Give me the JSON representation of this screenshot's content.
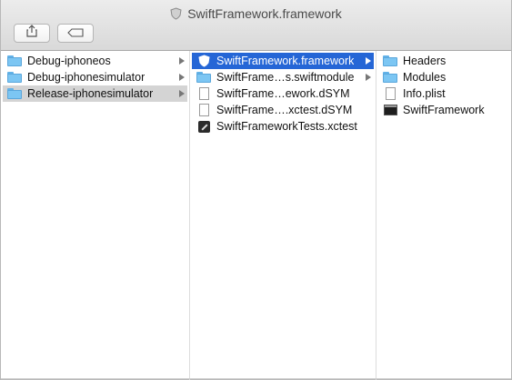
{
  "window": {
    "title": "SwiftFramework.framework"
  },
  "toolbar": {
    "share_icon": "share-icon",
    "tag_icon": "tag-icon"
  },
  "columns": {
    "col1": [
      {
        "label": "Debug-iphoneos",
        "icon": "folder-icon",
        "has_arrow": true,
        "state": "normal"
      },
      {
        "label": "Debug-iphonesimulator",
        "icon": "folder-icon",
        "has_arrow": true,
        "state": "normal"
      },
      {
        "label": "Release-iphonesimulator",
        "icon": "folder-icon",
        "has_arrow": true,
        "state": "selected-inactive"
      }
    ],
    "col2": [
      {
        "label": "SwiftFramework.framework",
        "icon": "framework-icon",
        "has_arrow": true,
        "state": "selected-active"
      },
      {
        "label": "SwiftFrame…s.swiftmodule",
        "icon": "folder-icon",
        "has_arrow": true,
        "state": "normal"
      },
      {
        "label": "SwiftFrame…ework.dSYM",
        "icon": "document-icon",
        "has_arrow": false,
        "state": "normal"
      },
      {
        "label": "SwiftFrame….xctest.dSYM",
        "icon": "document-icon",
        "has_arrow": false,
        "state": "normal"
      },
      {
        "label": "SwiftFrameworkTests.xctest",
        "icon": "xctest-icon",
        "has_arrow": false,
        "state": "normal"
      }
    ],
    "col3": [
      {
        "label": "Headers",
        "icon": "folder-icon",
        "has_arrow": false,
        "state": "normal"
      },
      {
        "label": "Modules",
        "icon": "folder-icon",
        "has_arrow": false,
        "state": "normal"
      },
      {
        "label": "Info.plist",
        "icon": "document-icon",
        "has_arrow": false,
        "state": "normal"
      },
      {
        "label": "SwiftFramework",
        "icon": "executable-icon",
        "has_arrow": false,
        "state": "normal"
      }
    ]
  },
  "colors": {
    "selection_active": "#2566d6",
    "selection_inactive": "#d4d4d4",
    "folder": "#7cc6f3"
  }
}
